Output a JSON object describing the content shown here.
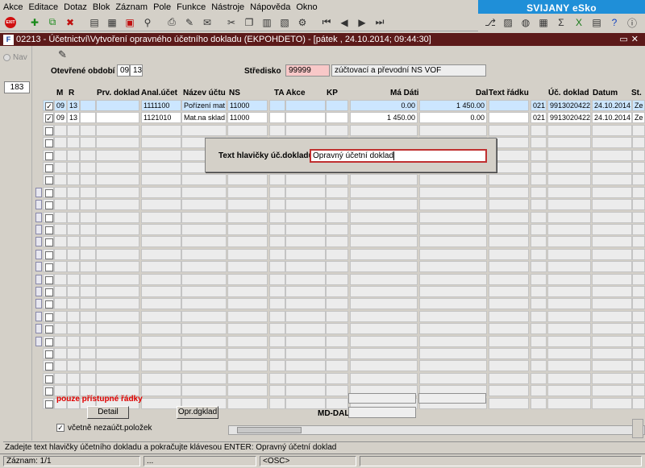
{
  "menu": [
    "Akce",
    "Editace",
    "Dotaz",
    "Blok",
    "Záznam",
    "Pole",
    "Funkce",
    "Nástroje",
    "Nápověda",
    "Okno"
  ],
  "brand": "SVIJANY eSko",
  "window_title": "02213 - Účetnictví\\Vytvoření opravného účetního dokladu (EKPOHDETO) - [pátek , 24.10.2014; 09:44:30]",
  "left": {
    "nav_label": "Nav",
    "record_count": "183"
  },
  "form": {
    "period_label": "Otevřené období",
    "period_month": "09",
    "period_year": "13",
    "center_label": "Středisko",
    "center_code": "99999",
    "center_name": "zúčtovací a převodní NS VOF"
  },
  "columns": [
    "M",
    "R",
    "Prv. doklad",
    "Anal.účet",
    "Název účtu",
    "NS",
    "TA Akce",
    "KP",
    "Má Dáti",
    "Dal",
    "Text řádku",
    "Úč. doklad",
    "Datum",
    "St."
  ],
  "rows": [
    {
      "checked": true,
      "m": "09",
      "r": "13",
      "prv": "",
      "anal": "1111100",
      "nazev": "Pořízení mat",
      "ns": "11000",
      "ta": "",
      "akce": "",
      "kp": "",
      "ma_dati": "0.00",
      "dal": "1 450.00",
      "text": "",
      "code": "021",
      "doklad": "9913020422",
      "datum": "24.10.2014",
      "st": "Ze"
    },
    {
      "checked": true,
      "m": "09",
      "r": "13",
      "prv": "",
      "anal": "1121010",
      "nazev": "Mat.na sklad",
      "ns": "11000",
      "ta": "",
      "akce": "",
      "kp": "",
      "ma_dati": "1 450.00",
      "dal": "0.00",
      "text": "",
      "code": "021",
      "doklad": "9913020422",
      "datum": "24.10.2014",
      "st": "Ze"
    }
  ],
  "dialog": {
    "label": "Text hlavičky úč.dokladu",
    "value": "Opravný účetní doklad"
  },
  "bottom": {
    "warning": "pouze přístupné řádky",
    "detail_button": "Detail",
    "opr_button": "Opr.dgklad",
    "md_dal_label": "MD-DAL",
    "include_label": "včetně nezaúčt.položek",
    "include_checked": true
  },
  "hint": "Zadejte text hlavičky účetního dokladu a pokračujte klávesou ENTER: Opravný účetní doklad",
  "status": {
    "record": "Záznam: 1/1",
    "mid": "...",
    "osc": "<OSC>"
  },
  "colors": {
    "brand_bg": "#1f8fd8",
    "title_bg": "#5c1a1a",
    "selected_row": "#cce6ff",
    "warning": "#e00000"
  }
}
